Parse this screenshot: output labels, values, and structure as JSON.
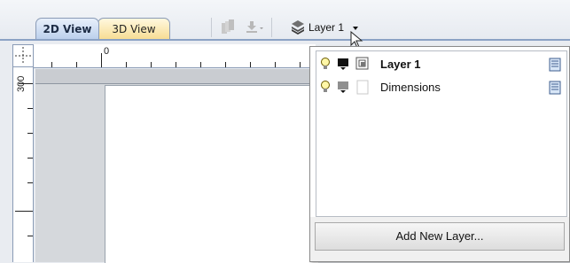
{
  "tabs": [
    {
      "label": "2D View",
      "active": true
    },
    {
      "label": "3D View",
      "active": false
    }
  ],
  "toolbar": {
    "layer_dropdown_label": "Layer 1",
    "icons": [
      "layers-stack-icon",
      "download-arrow-icon",
      "layer-icon"
    ]
  },
  "ruler": {
    "horizontal_label": "0",
    "vertical_label": "300"
  },
  "layer_panel": {
    "layers": [
      {
        "name": "Layer 1",
        "bold": true,
        "visible_icon": "lightbulb-icon",
        "color_icon": "monitor-black-icon",
        "type_icon": "layer-copy-icon",
        "edit_icon": "properties-icon"
      },
      {
        "name": "Dimensions",
        "bold": false,
        "visible_icon": "lightbulb-icon",
        "color_icon": "monitor-gray-icon",
        "type_icon": "blank-page-icon",
        "edit_icon": "properties-icon"
      }
    ],
    "add_button_label": "Add New Layer..."
  },
  "colors": {
    "tab_2d": "#bcd0ec",
    "tab_3d": "#f7dd94",
    "panel_border": "#8a8a8a",
    "ruler_border": "#8a9bb6"
  }
}
